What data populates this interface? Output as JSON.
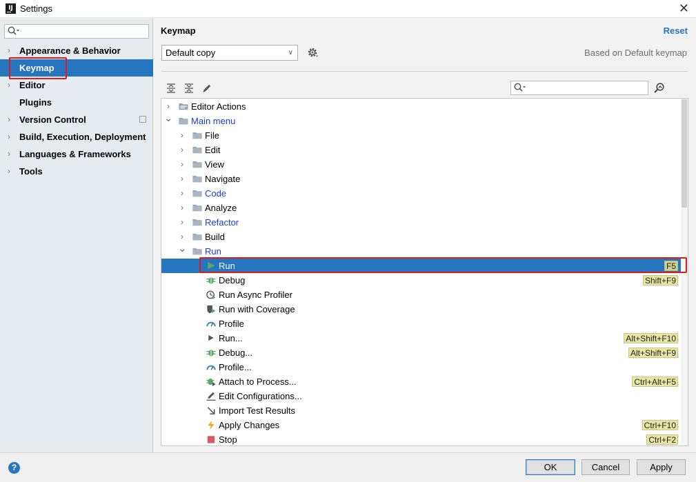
{
  "window": {
    "title": "Settings",
    "app_icon": "IJ",
    "close_glyph": "✕"
  },
  "sidebar": {
    "search_placeholder": "",
    "items": [
      {
        "label": "Appearance & Behavior",
        "expandable": true
      },
      {
        "label": "Keymap",
        "expandable": false,
        "selected": true
      },
      {
        "label": "Editor",
        "expandable": true
      },
      {
        "label": "Plugins",
        "expandable": false
      },
      {
        "label": "Version Control",
        "expandable": true
      },
      {
        "label": "Build, Execution, Deployment",
        "expandable": true
      },
      {
        "label": "Languages & Frameworks",
        "expandable": true
      },
      {
        "label": "Tools",
        "expandable": true
      }
    ]
  },
  "main": {
    "title": "Keymap",
    "reset_label": "Reset",
    "keymap_selected": "Default copy",
    "based_on": "Based on Default keymap",
    "tree_search_placeholder": ""
  },
  "tree": [
    {
      "label": "Editor Actions",
      "icon": "editor-actions-icon",
      "chevron": "right"
    },
    {
      "label": "Main menu",
      "icon": "folder-icon",
      "chevron": "down",
      "modified": true
    },
    {
      "label": "File",
      "icon": "folder-icon",
      "chevron": "right"
    },
    {
      "label": "Edit",
      "icon": "folder-icon",
      "chevron": "right"
    },
    {
      "label": "View",
      "icon": "folder-icon",
      "chevron": "right"
    },
    {
      "label": "Navigate",
      "icon": "folder-icon",
      "chevron": "right"
    },
    {
      "label": "Code",
      "icon": "folder-icon",
      "chevron": "right",
      "modified": true
    },
    {
      "label": "Analyze",
      "icon": "folder-icon",
      "chevron": "right"
    },
    {
      "label": "Refactor",
      "icon": "folder-icon",
      "chevron": "right",
      "modified": true
    },
    {
      "label": "Build",
      "icon": "folder-icon",
      "chevron": "right"
    },
    {
      "label": "Run",
      "icon": "folder-icon",
      "chevron": "down",
      "modified": true
    },
    {
      "label": "Run",
      "icon": "run-icon",
      "shortcut": "F5",
      "selected": true
    },
    {
      "label": "Debug",
      "icon": "debug-icon",
      "shortcut": "Shift+F9"
    },
    {
      "label": "Run Async Profiler",
      "icon": "profiler-icon"
    },
    {
      "label": "Run with Coverage",
      "icon": "coverage-icon"
    },
    {
      "label": "Profile",
      "icon": "profile-icon"
    },
    {
      "label": "Run...",
      "icon": "run-dots-icon",
      "shortcut": "Alt+Shift+F10"
    },
    {
      "label": "Debug...",
      "icon": "debug-icon",
      "shortcut": "Alt+Shift+F9"
    },
    {
      "label": "Profile...",
      "icon": "profile-icon"
    },
    {
      "label": "Attach to Process...",
      "icon": "attach-icon",
      "shortcut": "Ctrl+Alt+F5"
    },
    {
      "label": "Edit Configurations...",
      "icon": "edit-config-icon"
    },
    {
      "label": "Import Test Results",
      "icon": "import-icon"
    },
    {
      "label": "Apply Changes",
      "icon": "lightning-icon",
      "shortcut": "Ctrl+F10"
    },
    {
      "label": "Stop",
      "icon": "stop-icon",
      "shortcut": "Ctrl+F2"
    }
  ],
  "footer": {
    "help_label": "?",
    "ok_label": "OK",
    "cancel_label": "Cancel",
    "apply_label": "Apply"
  },
  "colors": {
    "selection": "#2675bf",
    "modified_text": "#1b3fd6",
    "shortcut_bg": "#e7e7a3",
    "highlight_box": "#e0191a"
  }
}
